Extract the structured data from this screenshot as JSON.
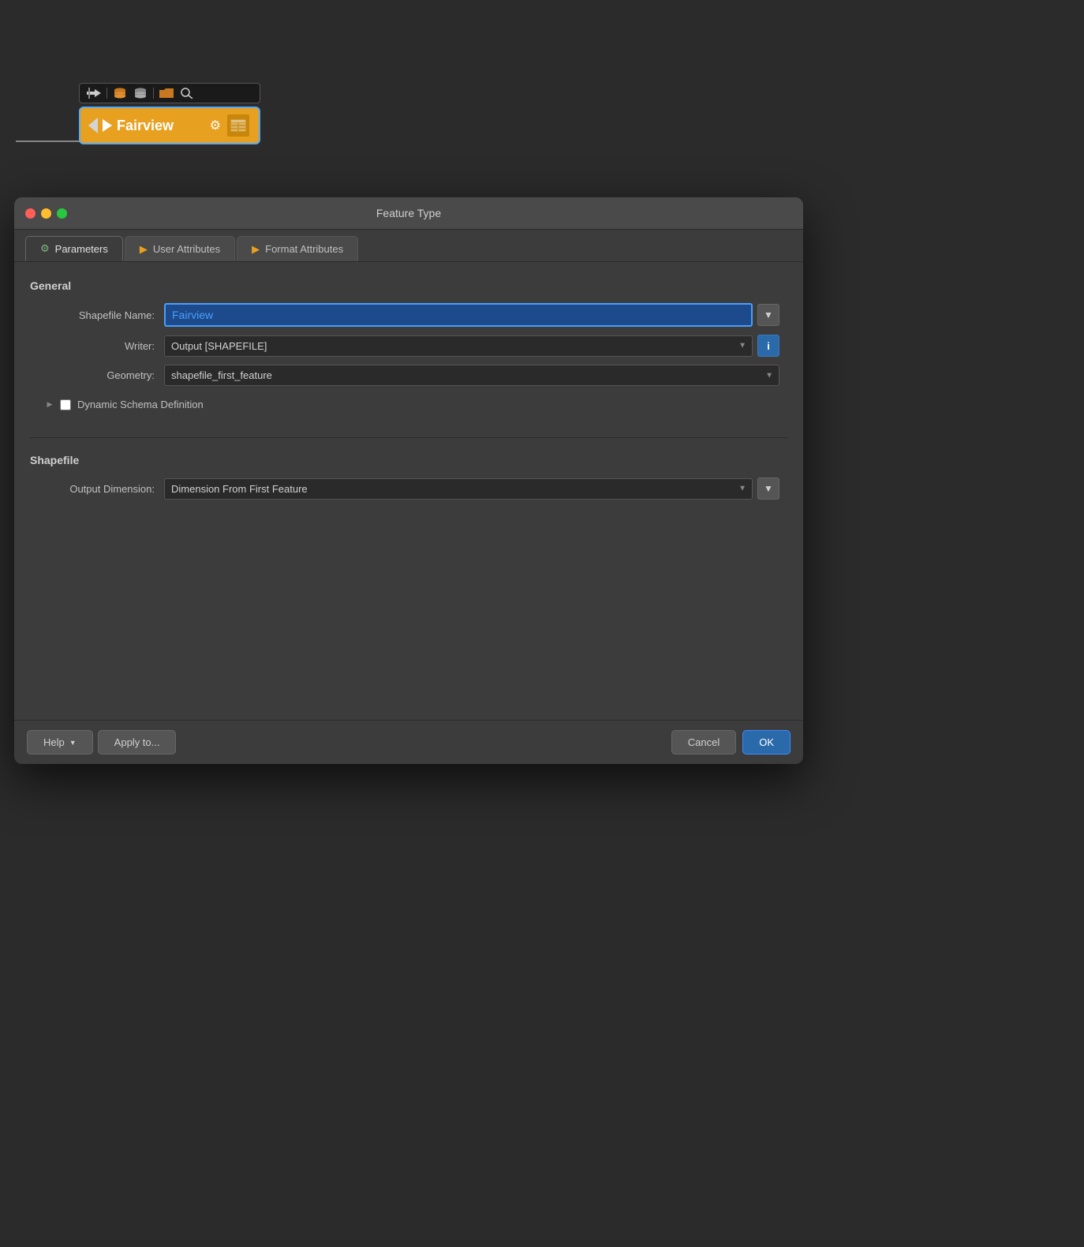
{
  "canvas": {
    "background": "#2b2b2b"
  },
  "node": {
    "label": "Fairview",
    "toolbar_icons": [
      "import-icon",
      "database-icon",
      "database-alt-icon",
      "folder-icon",
      "search-icon"
    ]
  },
  "dialog": {
    "title": "Feature Type",
    "traffic_lights": {
      "red": "close",
      "yellow": "minimize",
      "green": "maximize"
    },
    "tabs": [
      {
        "id": "parameters",
        "label": "Parameters",
        "icon": "gear",
        "active": true
      },
      {
        "id": "user-attributes",
        "label": "User Attributes",
        "icon": "orange-arrow",
        "active": false
      },
      {
        "id": "format-attributes",
        "label": "Format Attributes",
        "icon": "orange-arrow",
        "active": false
      }
    ],
    "general_section": {
      "title": "General",
      "fields": [
        {
          "label": "Shapefile Name:",
          "type": "text",
          "value": "Fairview",
          "has_button": true
        },
        {
          "label": "Writer:",
          "type": "dropdown",
          "value": "Output [SHAPEFILE]",
          "options": [
            "Output [SHAPEFILE]"
          ],
          "has_info_button": true
        },
        {
          "label": "Geometry:",
          "type": "dropdown",
          "value": "shapefile_first_feature",
          "options": [
            "shapefile_first_feature"
          ]
        }
      ],
      "dynamic_schema": {
        "label": "Dynamic Schema Definition",
        "checked": false
      }
    },
    "shapefile_section": {
      "title": "Shapefile",
      "fields": [
        {
          "label": "Output Dimension:",
          "type": "dropdown",
          "value": "Dimension From First Feature",
          "options": [
            "Dimension From First Feature"
          ],
          "has_button": true
        }
      ]
    },
    "footer": {
      "help_label": "Help",
      "apply_label": "Apply to...",
      "cancel_label": "Cancel",
      "ok_label": "OK"
    }
  }
}
